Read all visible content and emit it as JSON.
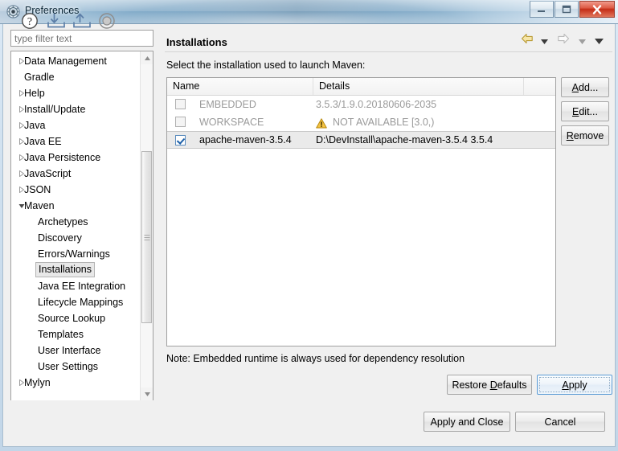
{
  "window": {
    "title": "Preferences",
    "icon": "preferences-gear-icon",
    "controls": {
      "minimize": "minimize-icon",
      "maximize": "maximize-icon",
      "close": "close-icon"
    }
  },
  "sidebar": {
    "filter": {
      "placeholder": "type filter text",
      "value": ""
    },
    "items": [
      {
        "label": "Data Management",
        "level": 1,
        "expandable": true,
        "expanded": false,
        "selected": false
      },
      {
        "label": "Gradle",
        "level": 1,
        "expandable": false,
        "expanded": false,
        "selected": false
      },
      {
        "label": "Help",
        "level": 1,
        "expandable": true,
        "expanded": false,
        "selected": false
      },
      {
        "label": "Install/Update",
        "level": 1,
        "expandable": true,
        "expanded": false,
        "selected": false
      },
      {
        "label": "Java",
        "level": 1,
        "expandable": true,
        "expanded": false,
        "selected": false
      },
      {
        "label": "Java EE",
        "level": 1,
        "expandable": true,
        "expanded": false,
        "selected": false
      },
      {
        "label": "Java Persistence",
        "level": 1,
        "expandable": true,
        "expanded": false,
        "selected": false
      },
      {
        "label": "JavaScript",
        "level": 1,
        "expandable": true,
        "expanded": false,
        "selected": false
      },
      {
        "label": "JSON",
        "level": 1,
        "expandable": true,
        "expanded": false,
        "selected": false
      },
      {
        "label": "Maven",
        "level": 1,
        "expandable": true,
        "expanded": true,
        "selected": false
      },
      {
        "label": "Archetypes",
        "level": 2,
        "expandable": false,
        "expanded": false,
        "selected": false
      },
      {
        "label": "Discovery",
        "level": 2,
        "expandable": false,
        "expanded": false,
        "selected": false
      },
      {
        "label": "Errors/Warnings",
        "level": 2,
        "expandable": false,
        "expanded": false,
        "selected": false
      },
      {
        "label": "Installations",
        "level": 2,
        "expandable": false,
        "expanded": false,
        "selected": true
      },
      {
        "label": "Java EE Integration",
        "level": 2,
        "expandable": false,
        "expanded": false,
        "selected": false
      },
      {
        "label": "Lifecycle Mappings",
        "level": 2,
        "expandable": false,
        "expanded": false,
        "selected": false
      },
      {
        "label": "Source Lookup",
        "level": 2,
        "expandable": false,
        "expanded": false,
        "selected": false
      },
      {
        "label": "Templates",
        "level": 2,
        "expandable": false,
        "expanded": false,
        "selected": false
      },
      {
        "label": "User Interface",
        "level": 2,
        "expandable": false,
        "expanded": false,
        "selected": false
      },
      {
        "label": "User Settings",
        "level": 2,
        "expandable": false,
        "expanded": false,
        "selected": false
      },
      {
        "label": "Mylyn",
        "level": 1,
        "expandable": true,
        "expanded": false,
        "selected": false
      }
    ]
  },
  "page": {
    "title": "Installations",
    "description": "Select the installation used to launch Maven:",
    "note": "Note: Embedded runtime is always used for dependency resolution",
    "nav": {
      "back_icon": "back-arrow-icon",
      "back_dropdown_icon": "chevron-down-icon",
      "forward_icon": "forward-arrow-icon",
      "forward_dropdown_icon": "chevron-down-icon",
      "menu_icon": "chevron-down-icon"
    }
  },
  "table": {
    "columns": [
      "Name",
      "Details",
      ""
    ],
    "rows": [
      {
        "checked": false,
        "enabled": false,
        "name": "EMBEDDED",
        "details": "3.5.3/1.9.0.20180606-2035",
        "warning": false
      },
      {
        "checked": false,
        "enabled": false,
        "name": "WORKSPACE",
        "details": "NOT AVAILABLE [3.0,)",
        "warning": true,
        "warning_icon": "warning-triangle-icon"
      },
      {
        "checked": true,
        "enabled": true,
        "name": "apache-maven-3.5.4",
        "details": "D:\\DevInstall\\apache-maven-3.5.4 3.5.4",
        "warning": false,
        "selected": true
      }
    ]
  },
  "side_buttons": [
    {
      "label": "Add...",
      "mnemonic": "A"
    },
    {
      "label": "Edit...",
      "mnemonic": "E"
    },
    {
      "label": "Remove",
      "mnemonic": "R"
    }
  ],
  "page_buttons": {
    "restore_defaults": {
      "pre": "Restore ",
      "mnemonic": "D",
      "post": "efaults"
    },
    "apply": {
      "pre": "",
      "mnemonic": "A",
      "post": "pply"
    }
  },
  "bottom_bar": {
    "icons": [
      {
        "name": "help-icon"
      },
      {
        "name": "import-preferences-icon"
      },
      {
        "name": "export-preferences-icon"
      },
      {
        "name": "oomph-record-icon"
      }
    ],
    "apply_and_close": "Apply and Close",
    "cancel": "Cancel"
  },
  "colors": {
    "accent_blue": "#1b5fa8",
    "warning_yellow": "#f5c342",
    "close_red": "#c42d17",
    "title_text": "#0b2636"
  }
}
